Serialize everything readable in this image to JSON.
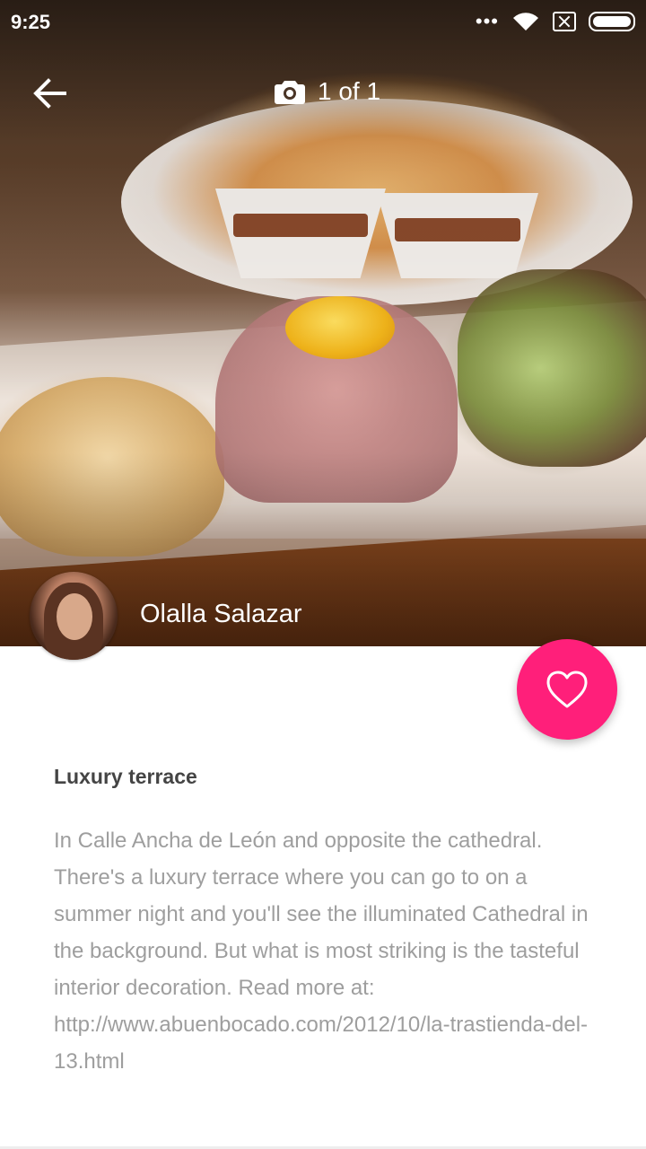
{
  "status_bar": {
    "time": "9:25",
    "icons": [
      "dots-icon",
      "wifi-icon",
      "sim-icon",
      "battery-icon"
    ]
  },
  "toolbar": {
    "back_icon": "arrow-left-icon",
    "camera_icon": "camera-icon",
    "photo_counter": "1 of 1"
  },
  "author": {
    "name": "Olalla Salazar"
  },
  "fab": {
    "icon": "heart-outline-icon",
    "color": "#ff1f7a"
  },
  "post": {
    "title": "Luxury terrace",
    "body": "In Calle Ancha de León and opposite the cathedral. There's a luxury terrace where you can go to on a summer night and you'll see the illuminated Cathedral in the background. But what is most striking is the tasteful interior decoration. Read more at: http://www.abuenbocado.com/2012/10/la-trastienda-del-13.html"
  },
  "colors": {
    "accent": "#ff1f7a",
    "title_text": "#444444",
    "body_text": "#9e9e9e"
  }
}
